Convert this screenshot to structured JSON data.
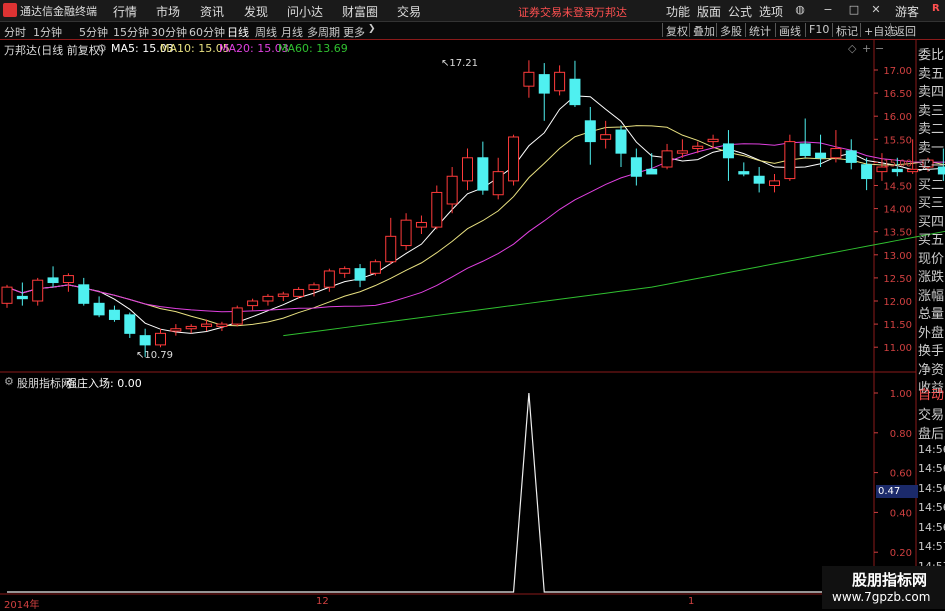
{
  "app": {
    "title": "通达信金融终端"
  },
  "menu": [
    "行情",
    "市场",
    "资讯",
    "发现",
    "问小达",
    "财富圈",
    "交易"
  ],
  "status_warning": "证券交易未登录",
  "stock_name": "万邦达",
  "right_menu": [
    "功能",
    "版面",
    "公式",
    "选项"
  ],
  "guest": "游客",
  "periods": [
    "分时",
    "1分钟",
    "5分钟",
    "15分钟",
    "30分钟",
    "60分钟",
    "日线",
    "周线",
    "月线",
    "多周期",
    "更多"
  ],
  "active_period": "日线",
  "tools": [
    "复权",
    "叠加",
    "多股",
    "统计",
    "画线",
    "F10",
    "标记",
    "+自选",
    "返回"
  ],
  "main_info": {
    "title": "万邦达(日线 前复权)",
    "ma5": "MA5: 15.03",
    "ma10": "MA10: 15.05",
    "ma20": "MA20: 15.03",
    "ma60": "MA60: 13.69"
  },
  "annotations": {
    "high": "17.21",
    "low": "10.79"
  },
  "price_axis": [
    "17.00",
    "16.50",
    "16.00",
    "15.50",
    "15.00",
    "14.50",
    "14.00",
    "13.50",
    "13.00",
    "12.50",
    "12.00",
    "11.50",
    "11.00"
  ],
  "indicator": {
    "title": "股朋指标网",
    "label": "强庄入场: 0.00"
  },
  "indicator_axis": [
    "1.00",
    "0.80",
    "0.60",
    "0.40",
    "0.20"
  ],
  "indicator_value_badge": "0.47",
  "date_axis": [
    "2014年",
    "12",
    "1"
  ],
  "quote_panel_labels": [
    "委比",
    "卖五",
    "卖四",
    "卖三",
    "卖二",
    "卖一",
    "买一",
    "买二",
    "买三",
    "买四",
    "买五",
    "现价",
    "涨跌",
    "涨幅",
    "总量",
    "外盘",
    "换手",
    "净资",
    "收益"
  ],
  "quote_panel_bottom": [
    "自动",
    "交易",
    "盘后",
    "14:56",
    "14:56",
    "14:56",
    "14:56",
    "14:56",
    "14:57",
    "14:57"
  ],
  "watermark": {
    "title": "股朋指标网",
    "url": "www.7gpzb.com"
  },
  "colors": {
    "up": "#ff3b3b",
    "down": "#4ff0f0",
    "ma5": "#ffffff",
    "ma10": "#e8e080",
    "ma20": "#e040e0",
    "ma60": "#30c030",
    "frame": "#8a1a1a"
  },
  "chart_data": {
    "type": "candlestick",
    "ylim": [
      10.6,
      17.3
    ],
    "candles": [
      {
        "o": 11.95,
        "h": 12.35,
        "l": 11.85,
        "c": 12.3
      },
      {
        "o": 12.1,
        "h": 12.4,
        "l": 11.9,
        "c": 12.05
      },
      {
        "o": 12.0,
        "h": 12.5,
        "l": 11.9,
        "c": 12.45
      },
      {
        "o": 12.5,
        "h": 12.75,
        "l": 12.3,
        "c": 12.4
      },
      {
        "o": 12.4,
        "h": 12.6,
        "l": 12.2,
        "c": 12.55
      },
      {
        "o": 12.35,
        "h": 12.5,
        "l": 11.9,
        "c": 11.95
      },
      {
        "o": 11.95,
        "h": 12.1,
        "l": 11.65,
        "c": 11.7
      },
      {
        "o": 11.8,
        "h": 11.9,
        "l": 11.55,
        "c": 11.6
      },
      {
        "o": 11.7,
        "h": 11.75,
        "l": 11.2,
        "c": 11.3
      },
      {
        "o": 11.25,
        "h": 11.4,
        "l": 10.79,
        "c": 11.05
      },
      {
        "o": 11.05,
        "h": 11.4,
        "l": 11.0,
        "c": 11.3
      },
      {
        "o": 11.35,
        "h": 11.5,
        "l": 11.25,
        "c": 11.4
      },
      {
        "o": 11.4,
        "h": 11.5,
        "l": 11.3,
        "c": 11.45
      },
      {
        "o": 11.45,
        "h": 11.6,
        "l": 11.35,
        "c": 11.5
      },
      {
        "o": 11.45,
        "h": 11.55,
        "l": 11.35,
        "c": 11.5
      },
      {
        "o": 11.5,
        "h": 11.9,
        "l": 11.45,
        "c": 11.85
      },
      {
        "o": 11.9,
        "h": 12.05,
        "l": 11.8,
        "c": 12.0
      },
      {
        "o": 12.0,
        "h": 12.15,
        "l": 11.9,
        "c": 12.1
      },
      {
        "o": 12.1,
        "h": 12.2,
        "l": 12.0,
        "c": 12.15
      },
      {
        "o": 12.1,
        "h": 12.3,
        "l": 12.05,
        "c": 12.25
      },
      {
        "o": 12.25,
        "h": 12.4,
        "l": 12.1,
        "c": 12.35
      },
      {
        "o": 12.3,
        "h": 12.7,
        "l": 12.2,
        "c": 12.65
      },
      {
        "o": 12.6,
        "h": 12.75,
        "l": 12.5,
        "c": 12.7
      },
      {
        "o": 12.7,
        "h": 12.8,
        "l": 12.3,
        "c": 12.45
      },
      {
        "o": 12.6,
        "h": 12.9,
        "l": 12.55,
        "c": 12.85
      },
      {
        "o": 12.85,
        "h": 13.8,
        "l": 12.8,
        "c": 13.4
      },
      {
        "o": 13.2,
        "h": 13.9,
        "l": 13.1,
        "c": 13.75
      },
      {
        "o": 13.6,
        "h": 13.85,
        "l": 13.45,
        "c": 13.7
      },
      {
        "o": 13.6,
        "h": 14.5,
        "l": 13.55,
        "c": 14.35
      },
      {
        "o": 14.1,
        "h": 14.9,
        "l": 13.9,
        "c": 14.7
      },
      {
        "o": 14.6,
        "h": 15.3,
        "l": 14.4,
        "c": 15.1
      },
      {
        "o": 15.1,
        "h": 15.45,
        "l": 14.3,
        "c": 14.4
      },
      {
        "o": 14.3,
        "h": 15.1,
        "l": 14.2,
        "c": 14.8
      },
      {
        "o": 14.6,
        "h": 15.6,
        "l": 14.5,
        "c": 15.55
      },
      {
        "o": 16.65,
        "h": 17.21,
        "l": 16.4,
        "c": 16.95
      },
      {
        "o": 16.9,
        "h": 17.15,
        "l": 15.9,
        "c": 16.5
      },
      {
        "o": 16.55,
        "h": 17.1,
        "l": 16.45,
        "c": 16.95
      },
      {
        "o": 16.8,
        "h": 17.2,
        "l": 16.2,
        "c": 16.25
      },
      {
        "o": 15.9,
        "h": 16.2,
        "l": 14.95,
        "c": 15.45
      },
      {
        "o": 15.5,
        "h": 15.9,
        "l": 15.3,
        "c": 15.6
      },
      {
        "o": 15.7,
        "h": 15.8,
        "l": 14.9,
        "c": 15.2
      },
      {
        "o": 15.1,
        "h": 15.3,
        "l": 14.5,
        "c": 14.7
      },
      {
        "o": 14.85,
        "h": 15.2,
        "l": 14.75,
        "c": 14.75
      },
      {
        "o": 14.9,
        "h": 15.4,
        "l": 14.85,
        "c": 15.25
      },
      {
        "o": 15.2,
        "h": 15.5,
        "l": 15.1,
        "c": 15.25
      },
      {
        "o": 15.3,
        "h": 15.45,
        "l": 15.2,
        "c": 15.35
      },
      {
        "o": 15.45,
        "h": 15.6,
        "l": 15.3,
        "c": 15.5
      },
      {
        "o": 15.4,
        "h": 15.7,
        "l": 14.6,
        "c": 15.1
      },
      {
        "o": 14.8,
        "h": 15.0,
        "l": 14.7,
        "c": 14.75
      },
      {
        "o": 14.7,
        "h": 14.9,
        "l": 14.35,
        "c": 14.55
      },
      {
        "o": 14.5,
        "h": 14.75,
        "l": 14.35,
        "c": 14.6
      },
      {
        "o": 14.65,
        "h": 15.6,
        "l": 14.6,
        "c": 15.45
      },
      {
        "o": 15.4,
        "h": 15.95,
        "l": 15.1,
        "c": 15.15
      },
      {
        "o": 15.2,
        "h": 15.6,
        "l": 14.9,
        "c": 15.1
      },
      {
        "o": 15.1,
        "h": 15.7,
        "l": 15.0,
        "c": 15.3
      },
      {
        "o": 15.25,
        "h": 15.5,
        "l": 14.85,
        "c": 15.0
      },
      {
        "o": 14.95,
        "h": 15.1,
        "l": 14.4,
        "c": 14.65
      },
      {
        "o": 14.8,
        "h": 15.2,
        "l": 14.6,
        "c": 14.9
      },
      {
        "o": 14.85,
        "h": 15.1,
        "l": 14.7,
        "c": 14.8
      },
      {
        "o": 14.8,
        "h": 15.5,
        "l": 14.75,
        "c": 14.85
      },
      {
        "o": 14.9,
        "h": 15.1,
        "l": 14.8,
        "c": 15.05
      },
      {
        "o": 14.9,
        "h": 15.3,
        "l": 14.6,
        "c": 14.75
      },
      {
        "o": 15.05,
        "h": 15.1,
        "l": 14.8,
        "c": 14.85
      },
      {
        "o": 15.0,
        "h": 15.65,
        "l": 14.8,
        "c": 14.85
      },
      {
        "o": 14.8,
        "h": 15.2,
        "l": 14.7,
        "c": 15.0
      },
      {
        "o": 14.8,
        "h": 15.5,
        "l": 14.75,
        "c": 15.4
      }
    ],
    "ma60": [
      [
        18,
        11.25
      ],
      [
        42,
        12.3
      ],
      [
        64,
        13.69
      ]
    ],
    "indicator": {
      "spike_index": 34,
      "values_nonzero": {
        "34": 1.0
      },
      "ylim": [
        0,
        1.05
      ]
    }
  }
}
